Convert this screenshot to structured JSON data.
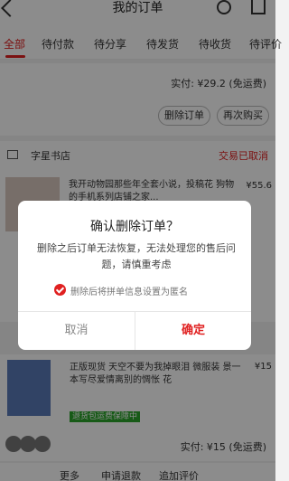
{
  "header": {
    "title": "我的订单"
  },
  "tabs": [
    "全部",
    "待付款",
    "待分享",
    "待发货",
    "待收货",
    "待评价"
  ],
  "order1": {
    "paid_label": "实付: ¥29.2 (免运费)",
    "delete_label": "删除订单",
    "rebuy_label": "再次购买"
  },
  "order2": {
    "store_name": "字星书店",
    "status": "交易已取消",
    "product_title": "我开动物园那些年全套小说，投稿花 狗物的手机系列店铺之家...",
    "price": "¥55.6"
  },
  "order3": {
    "product_title": "正版现货 天空不要为我掉眼泪 微服装 景一本写尽爱情离别的惆怅 花",
    "price": "¥15",
    "tag": "退货包运费保障中",
    "paid_label": "实付: ¥15 (免运费)"
  },
  "bottom": {
    "more": "更多",
    "apply": "申请退款",
    "review": "追加评价"
  },
  "dialog": {
    "title": "确认删除订单？",
    "message": "删除之后订单无法恢复，无法处理您的售后问题，请慎重考虑",
    "checkbox_label": "删除后将拼单信息设置为匿名",
    "checkbox_checked": true,
    "cancel": "取消",
    "confirm": "确定"
  },
  "colors": {
    "accent": "#e02020",
    "green": "#2aa52a"
  }
}
